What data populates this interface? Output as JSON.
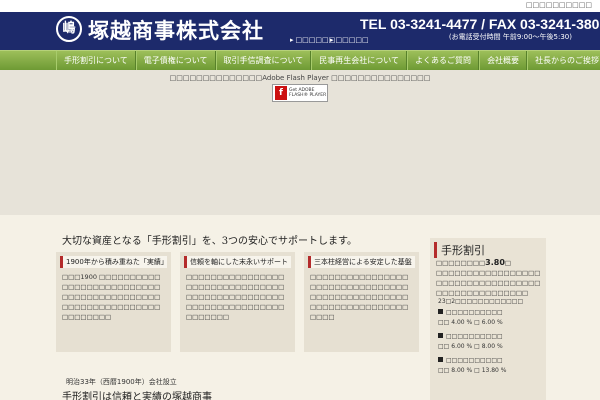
{
  "topbar": {
    "sitemap_label": "□□□□□□□□□□"
  },
  "header": {
    "logo_glyph": "嶋",
    "company_name": "塚越商事株式会社",
    "tel": "TEL 03-3241-4477 / FAX 03-3241-3806",
    "hours": "(お電話受付時間 午前9:00〜午後5:30)",
    "links": [
      {
        "label": "□□□□□□"
      },
      {
        "label": "□□□□□"
      }
    ]
  },
  "nav": {
    "items": [
      "手形割引について",
      "電子債権について",
      "取引手信調査について",
      "民事再生会社について",
      "よくあるご質問",
      "会社概要",
      "社長からのご挨拶"
    ]
  },
  "flash": {
    "message": "□□□□□□□□□□□□□□Adobe Flash Player □□□□□□□□□□□□□□□",
    "badge_icon": "f",
    "badge_text_1": "Get ADOBE",
    "badge_text_2": "FLASH® PLAYER"
  },
  "content": {
    "lead": "大切な資産となる「手形割引」を、3つの安心でサポートします。",
    "cards": [
      {
        "title": "1900年から積み重ねた「実績」",
        "body": "□□□1900 □□□□□□□□□□□□□□□□□□□□□□□□□□□□□□□□□□□□□□□□□□□□□□□□□□□□□□□□□□□□□□□□□□"
      },
      {
        "title": "信頼を軸にした末永いサポート",
        "body": "□□□□□□□□□□□□□□□□□□□□□□□□□□□□□□□□□□□□□□□□□□□□□□□□□□□□□□□□□□□□□□□□□□□□□□□"
      },
      {
        "title": "三本柱経営による安定した基盤",
        "body": "□□□□□□□□□□□□□□□□□□□□□□□□□□□□□□□□□□□□□□□□□□□□□□□□□□□□□□□□□□□□□□□□□□□□"
      }
    ],
    "founded": "明治33年（西暦1900年）会社設立",
    "tagline": "手形割引は信頼と実績の塚越商事"
  },
  "sidebar": {
    "title": "手形割引",
    "rate_prefix": "□□□□□□□□",
    "rate_value": "3.80",
    "rate_suffix": "□",
    "description": "□□□□□□□□□□□□□□□□□□□□□□□□□□□□□□□□□□□□□□□□□□□□□□□□□",
    "date_note": "23□2□□□□□□□□□□□□",
    "rate_items": [
      {
        "label": "□□□□□□□□□□",
        "range": "□□ 4.00 % □ 6.00 %"
      },
      {
        "label": "□□□□□□□□□□",
        "range": "□□ 6.00 % □ 8.00 %"
      },
      {
        "label": "□□□□□□□□□□",
        "range": "□□ 8.00 % □ 13.80 %"
      }
    ]
  },
  "colors": {
    "header_bg": "#1d2a6b",
    "nav_green": "#7fa843",
    "accent_red": "#b42b2b",
    "page_bg": "#f5f1e6"
  }
}
